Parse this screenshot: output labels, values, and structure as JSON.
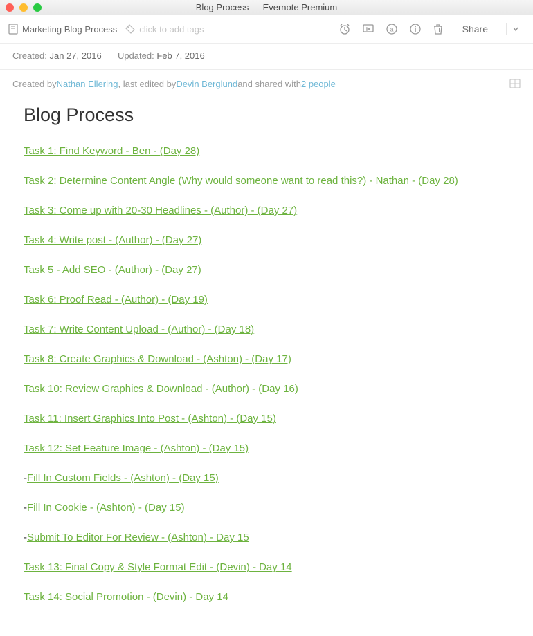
{
  "window": {
    "title": "Blog Process — Evernote Premium"
  },
  "toolbar": {
    "notebook_name": "Marketing Blog Process",
    "add_tags_placeholder": "click to add tags",
    "share_label": "Share"
  },
  "meta": {
    "created_label": "Created:",
    "created_value": "Jan 27, 2016",
    "updated_label": "Updated:",
    "updated_value": "Feb 7, 2016"
  },
  "authoring": {
    "created_by_label": "Created by ",
    "creator": "Nathan Ellering",
    "last_edited_label": ", last edited by ",
    "editor": "Devin Berglund",
    "shared_label": " and shared with ",
    "shared_count": "2 people"
  },
  "note": {
    "title": "Blog Process",
    "tasks": [
      {
        "prefix": "",
        "text": "Task 1: Find Keyword - Ben - (Day 28)"
      },
      {
        "prefix": "",
        "text": "Task 2: Determine Content Angle (Why would someone want to read this?) - Nathan - (Day 28)"
      },
      {
        "prefix": "",
        "text": "Task 3: Come up with 20-30 Headlines - (Author) - (Day 27)"
      },
      {
        "prefix": "",
        "text": "Task 4: Write post - (Author) - (Day 27)"
      },
      {
        "prefix": "",
        "text": "Task 5 - Add SEO - (Author) - (Day 27)"
      },
      {
        "prefix": "",
        "text": "Task 6: Proof Read - (Author) - (Day 19)"
      },
      {
        "prefix": "",
        "text": "Task 7: Write Content Upload - (Author) - (Day 18)"
      },
      {
        "prefix": "",
        "text": "Task 8: Create Graphics & Download - (Ashton) - (Day 17)"
      },
      {
        "prefix": "",
        "text": "Task 10: Review Graphics & Download - (Author) - (Day 16)"
      },
      {
        "prefix": "",
        "text": "Task 11: Insert Graphics Into Post - (Ashton) - (Day 15)"
      },
      {
        "prefix": "",
        "text": "Task 12: Set Feature Image - (Ashton) - (Day 15)"
      },
      {
        "prefix": "-",
        "text": "Fill In Custom Fields - (Ashton) - (Day 15)"
      },
      {
        "prefix": "-",
        "text": "Fill In Cookie - (Ashton) - (Day 15)"
      },
      {
        "prefix": "-",
        "text": "Submit To Editor For Review - (Ashton) - Day 15"
      },
      {
        "prefix": "",
        "text": "Task 13: Final Copy & Style Format Edit - (Devin) - Day 14"
      },
      {
        "prefix": "",
        "text": "Task 14: Social Promotion - (Devin) - Day 14"
      }
    ]
  }
}
